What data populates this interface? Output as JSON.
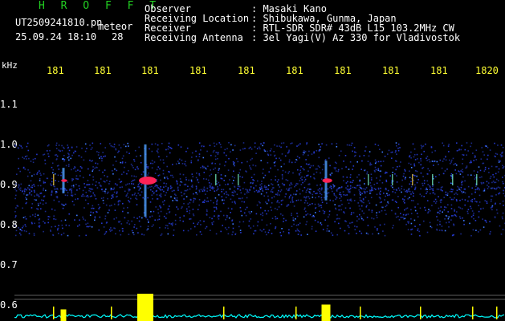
{
  "app": {
    "title": "H R O F F T"
  },
  "file": {
    "name": "UT2509241810.pn",
    "type_label": "meteor",
    "datetime": "25.09.24 18:10",
    "counter": "28"
  },
  "info": [
    {
      "label": "Observer",
      "value": ": Masaki Kano"
    },
    {
      "label": "Receiving Location",
      "value": ": Shibukawa, Gunma, Japan"
    },
    {
      "label": "Receiver",
      "value": ": RTL-SDR SDR# 43dB L15 103.2MHz CW"
    },
    {
      "label": "Receiving Antenna",
      "value": ": 3el Yagi(V) Az 330 for Vladivostok"
    }
  ],
  "axis": {
    "unit": "kHz",
    "x_ticks": [
      "181",
      "181",
      "181",
      "181",
      "181",
      "181",
      "181",
      "181",
      "181",
      "1820"
    ],
    "y_ticks": [
      "1.1",
      "1.0",
      "0.9",
      "0.8",
      "0.7",
      "0.6"
    ]
  },
  "colors": {
    "background": "#000000",
    "title": "#22d022",
    "text": "#ffffff",
    "tick": "#ffff33",
    "noise": "#1a2a8a",
    "signal_core": "#ff2255",
    "spike": "#ffff00",
    "baseline": "#00ffff"
  },
  "chart_data": {
    "type": "heatmap",
    "xlabel": "",
    "ylabel": "kHz",
    "ylim": [
      0.57,
      1.17
    ],
    "noise_band_khz": [
      0.8,
      1.0
    ],
    "signal_carrier_khz": 0.92,
    "echoes": [
      {
        "tick_index": 2.05,
        "strength": "strong"
      },
      {
        "tick_index": 5.8,
        "strength": "medium"
      },
      {
        "tick_index": 0.35,
        "strength": "weak"
      }
    ]
  }
}
